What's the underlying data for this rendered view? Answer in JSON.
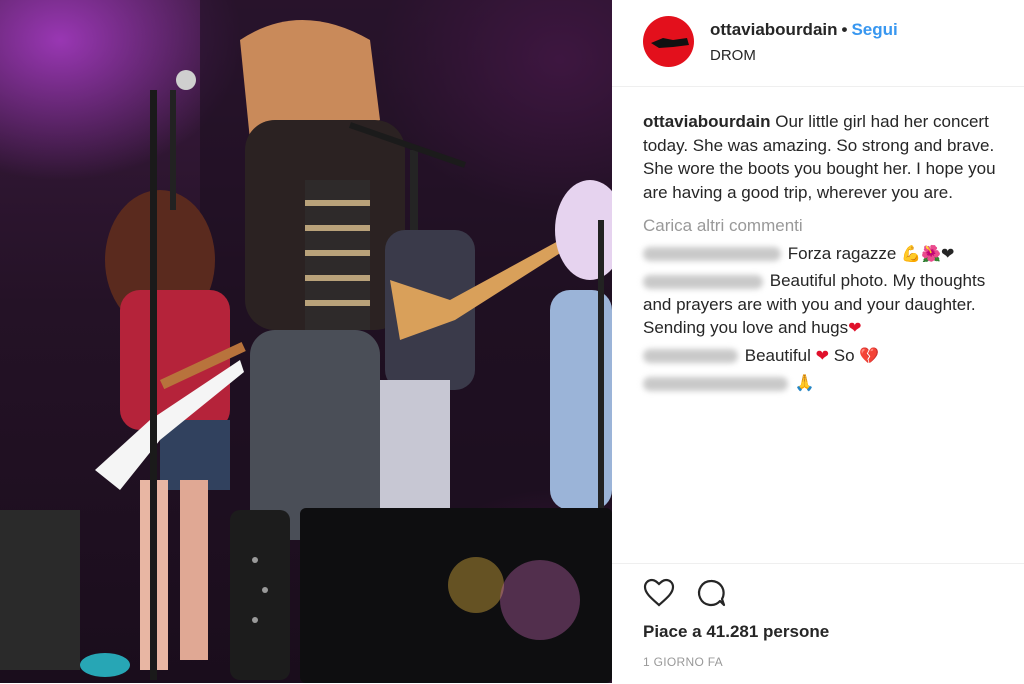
{
  "post": {
    "username": "ottaviabourdain",
    "separator": "•",
    "follow_label": "Segui",
    "location": "DROM",
    "caption_user": "ottaviabourdain",
    "caption_text": "Our little girl had her concert today. She was amazing. So strong and brave. She wore the boots you bought her. I hope you are having a good trip, wherever you are."
  },
  "comments_section": {
    "load_more_label": "Carica altri commenti",
    "items": [
      {
        "text": "Forza ragazze ",
        "emojis": "💪🌺❤"
      },
      {
        "text": "Beautiful photo. My thoughts and prayers are with you and your daughter. Sending you love and hugs",
        "emojis": "❤"
      },
      {
        "text": "Beautiful ",
        "emoji_mid": "❤",
        "text2": " So ",
        "emojis": "💔"
      },
      {
        "text": "",
        "emojis": "🙏"
      }
    ]
  },
  "footer": {
    "likes_text": "Piace a 41.281 persone",
    "timestamp": "1 GIORNO FA"
  },
  "icons": {
    "like": "heart-outline-icon",
    "comment": "speech-bubble-icon"
  },
  "colors": {
    "follow": "#3897f0",
    "avatar_bg": "#e3101c",
    "heart": "#e0102b",
    "muted": "#999999"
  }
}
